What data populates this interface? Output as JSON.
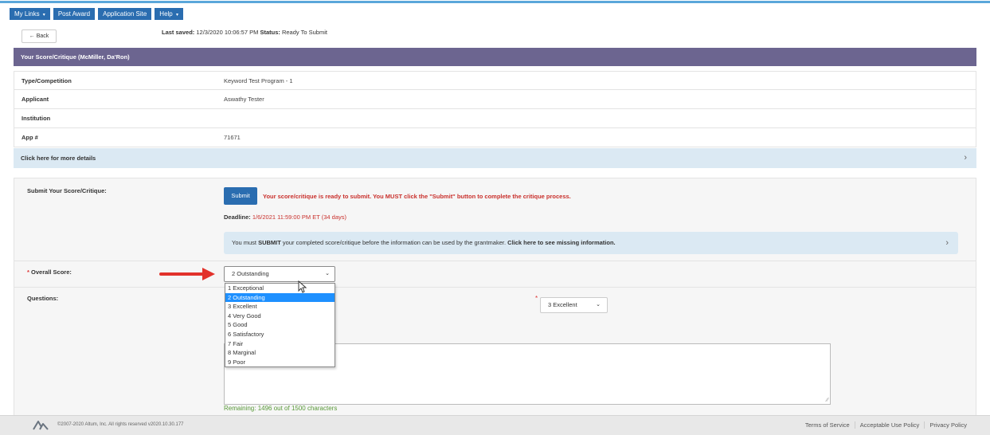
{
  "nav": {
    "items": [
      {
        "label": "My Links",
        "caret": "▾"
      },
      {
        "label": "Post Award",
        "caret": ""
      },
      {
        "label": "Application Site",
        "caret": ""
      },
      {
        "label": "Help",
        "caret": "▾"
      }
    ]
  },
  "back": {
    "label": "Back",
    "icon": "arrow-left-icon"
  },
  "status_bar": {
    "last_saved_label": "Last saved:",
    "last_saved_value": "12/3/2020 10:06:57 PM",
    "status_label": "Status:",
    "status_value": "Ready To Submit"
  },
  "panel": {
    "title": "Your Score/Critique (McMiller, Da'Ron)"
  },
  "info": {
    "rows": [
      {
        "label": "Type/Competition",
        "value": "Keyword Test Program - 1"
      },
      {
        "label": "Applicant",
        "value": "Aswathy Tester"
      },
      {
        "label": "Institution",
        "value": ""
      },
      {
        "label": "App #",
        "value": "71671"
      }
    ],
    "details_link": "Click here for more details"
  },
  "submit_section": {
    "label": "Submit Your Score/Critique:",
    "button": "Submit",
    "ready_message": "Your score/critique is ready to submit. You MUST click the \"Submit\" button to complete the critique process.",
    "deadline_label": "Deadline:",
    "deadline_value": "1/6/2021 11:59:00 PM ET (34 days)",
    "missing_text_pre": "You must ",
    "missing_text_bold1": "SUBMIT",
    "missing_text_mid": " your completed score/critique before the information can be used by the grantmaker. ",
    "missing_text_link": "Click here to see missing information."
  },
  "overall_score": {
    "required_mark": "*",
    "label": "Overall Score:",
    "selected": "2 Outstanding",
    "options": [
      "1 Exceptional",
      "2 Outstanding",
      "3 Excellent",
      "4 Very Good",
      "5 Good",
      "6 Satisfactory",
      "7 Fair",
      "8 Marginal",
      "9 Poor"
    ]
  },
  "questions": {
    "label": "Questions:",
    "required_mark": "*",
    "select_value": "3 Excellent",
    "remaining": "Remaining: 1496 out of 1500 characters"
  },
  "footer": {
    "copyright": "©2007-2020 Altum, Inc. All rights reserved   v2020.10.30.177",
    "links": [
      "Terms of Service",
      "Acceptable Use Policy",
      "Privacy Policy"
    ]
  },
  "colors": {
    "nav_blue": "#2a6db0",
    "header_purple": "#6c6590",
    "info_blue": "#dbe9f3",
    "alert_red": "#c9302c",
    "remaining_green": "#5a9a3a",
    "selected_option": "#1e90ff"
  }
}
